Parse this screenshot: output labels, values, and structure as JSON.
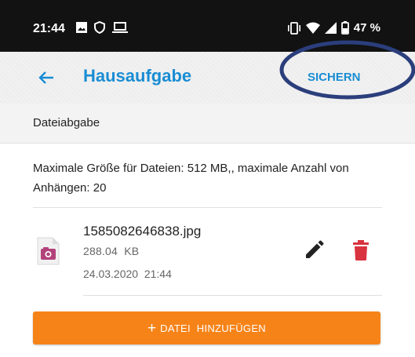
{
  "status_bar": {
    "time": "21:44",
    "left_icons": [
      "image-icon",
      "shield-icon",
      "laptop-icon"
    ],
    "right_icons": [
      "vibrate-icon",
      "wifi-icon",
      "signal-icon",
      "battery-icon"
    ],
    "battery": "47 %"
  },
  "app_bar": {
    "back_icon": "arrow-left-icon",
    "title": "Hausaufgabe",
    "save_label": "SICHERN"
  },
  "section": {
    "title": "Dateiabgabe",
    "info": "Maximale Größe für Dateien: 512 MB,, maximale Anzahl von Anhängen: 20"
  },
  "attachment": {
    "icon": "image-file-icon",
    "file_name": "1585082646838.jpg",
    "size": "288.04  KB",
    "date": "24.03.2020  21:44",
    "edit_icon": "pencil-icon",
    "delete_icon": "trash-icon"
  },
  "add_button": {
    "plus": "+",
    "label": "DATEI  HINZUFÜGEN"
  },
  "colors": {
    "accent_blue": "#1a8dd4",
    "orange": "#f68318",
    "delete_red": "#d8333f",
    "annotation_oval": "#2b3e7c",
    "status_bar": "#121212"
  }
}
